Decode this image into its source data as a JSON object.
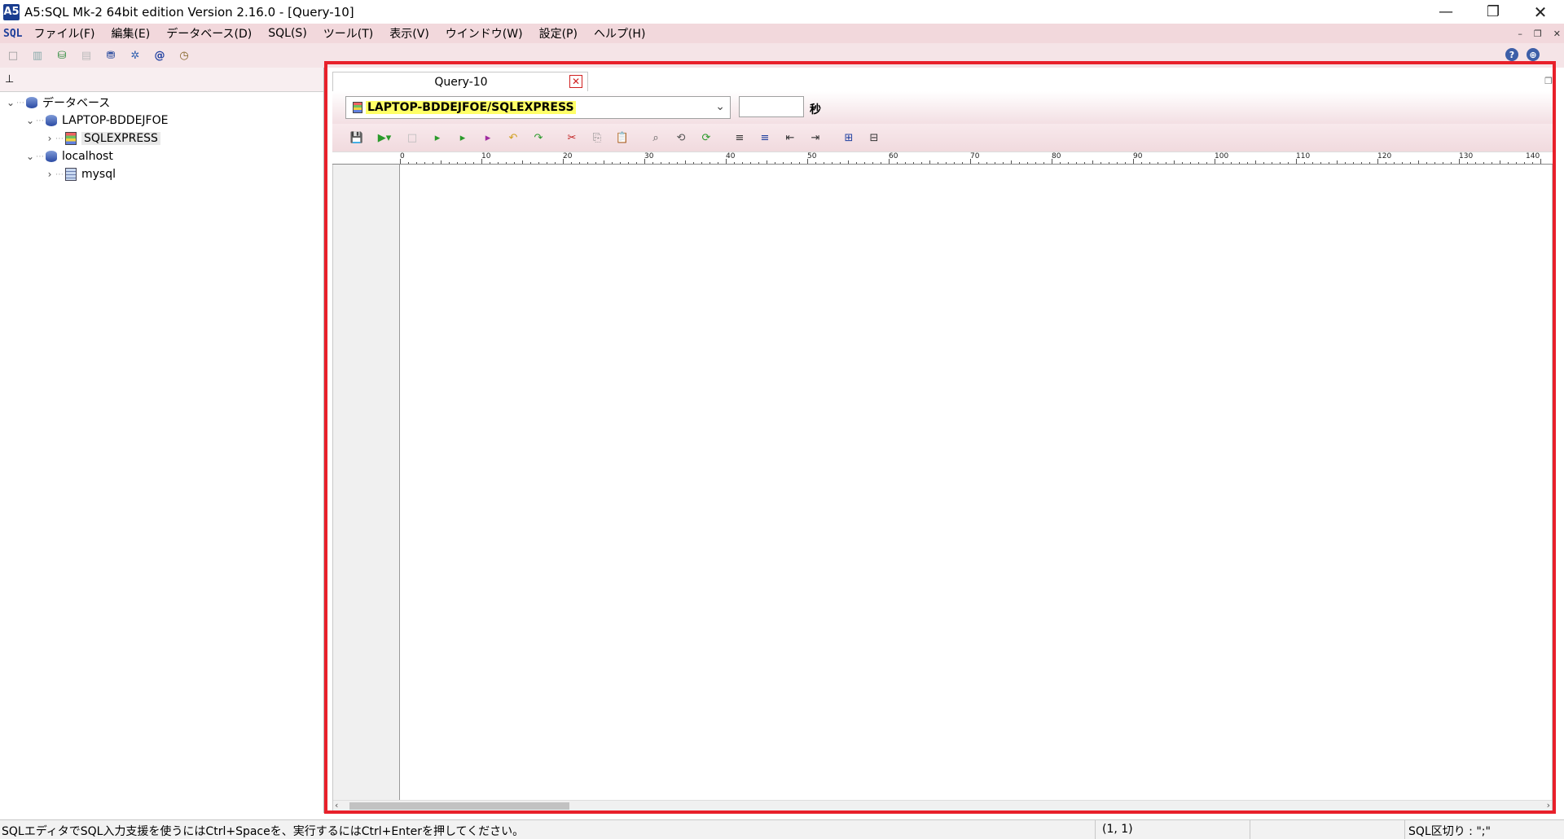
{
  "window": {
    "app_icon": "A5",
    "title": "A5:SQL Mk-2 64bit edition Version 2.16.0 - [Query-10]",
    "minimize": "—",
    "maximize": "❐",
    "close": "✕"
  },
  "menubar": {
    "logo": "SQL",
    "items": [
      "ファイル(F)",
      "編集(E)",
      "データベース(D)",
      "SQL(S)",
      "ツール(T)",
      "表示(V)",
      "ウインドウ(W)",
      "設定(P)",
      "ヘルプ(H)"
    ],
    "mdi_min": "–",
    "mdi_restore": "❐",
    "mdi_close": "✕"
  },
  "main_toolbar": {
    "icons": [
      "new-file-icon",
      "open-file-icon",
      "connect-icon",
      "disconnect-icon",
      "database-icon",
      "settings-icon",
      "at-icon",
      "clock-icon"
    ],
    "glyphs": [
      "□",
      "▥",
      "⛁",
      "▤",
      "⛃",
      "✲",
      "@",
      "◷"
    ]
  },
  "help_icons": {
    "help": "?",
    "web": "⊕"
  },
  "tree": {
    "header_icon": "⊥",
    "root": "データベース",
    "server1": "LAPTOP-BDDEJFOE",
    "server1_db": "SQLEXPRESS",
    "server2": "localhost",
    "server2_db": "mysql"
  },
  "query_tab": {
    "label": "Query-10",
    "close": "✕"
  },
  "connection": {
    "selected": "LAPTOP-BDDEJFOE/SQLEXPRESS",
    "timeout_value": "",
    "seconds_label": "秒"
  },
  "editor_toolbar": {
    "glyphs": [
      "💾",
      "▶▾",
      "□",
      "▸",
      "▸",
      "▸",
      "↶",
      "↷",
      "✂",
      "⎘",
      "📋",
      "⌕",
      "⟲",
      "⟳",
      "≡",
      "≡",
      "⇤",
      "⇥",
      "⊞",
      "⊟"
    ]
  },
  "ruler": {
    "labels": [
      "0",
      "10",
      "20",
      "30",
      "40",
      "50",
      "60",
      "70",
      "80",
      "90",
      "100",
      "110",
      "120",
      "130",
      "140"
    ]
  },
  "scrollbar": {
    "left": "‹",
    "right": "›"
  },
  "statusbar": {
    "message": "SQLエディタでSQL入力支援を使うにはCtrl+Spaceを、実行するにはCtrl+Enterを押してください。",
    "position": "(1, 1)",
    "delimiter": "SQL区切り : \";\""
  }
}
